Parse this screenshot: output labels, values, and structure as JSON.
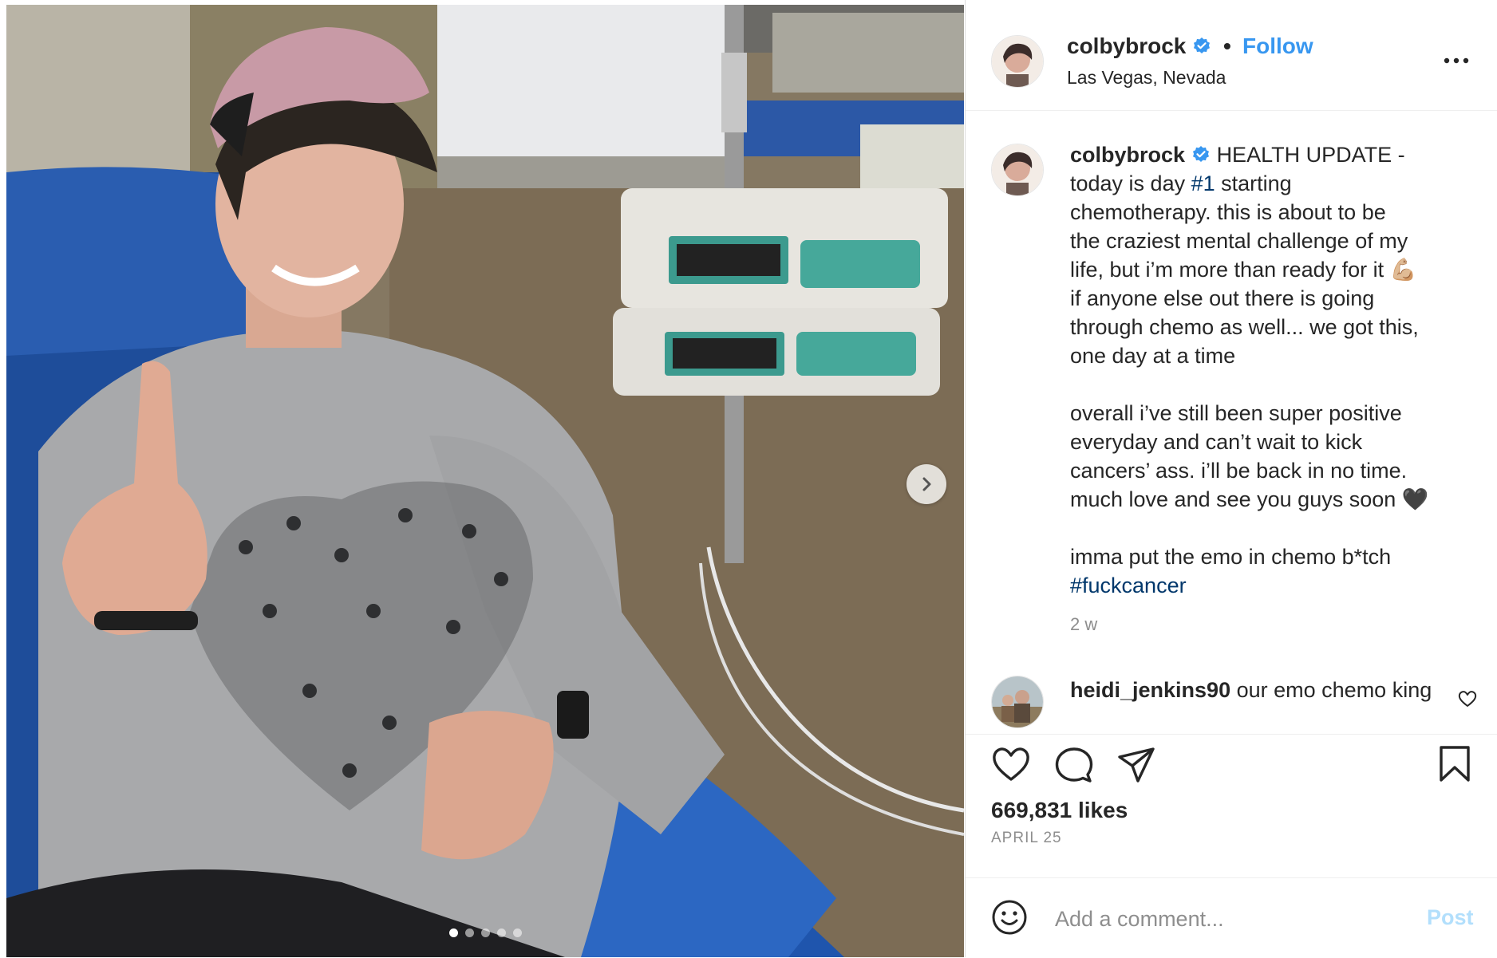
{
  "post": {
    "username": "colbybrock",
    "follow_label": "Follow",
    "separator": "•",
    "location": "Las Vegas, Nevada",
    "caption_lines": [
      "HEALTH UPDATE -",
      "today is day ",
      "#1",
      " starting\nchemotherapy. this is about to be\nthe craziest mental challenge of my\nlife, but i’m more than ready for it 💪🏼\nif anyone else out there is going\nthrough chemo as well... we got this,\none day at a time\n\noverall i’ve still been super positive\neveryday and can’t wait to kick\ncancers’ ass. i’ll be back in no time.\nmuch love and see you guys soon 🖤\n\nimma put the emo in chemo b*tch\n",
      "#fuckcancer"
    ],
    "time_ago": "2 w",
    "likes": "669,831 likes",
    "date": "APRIL 25"
  },
  "comment": {
    "username": "heidi_jenkins90",
    "text": "our emo chemo king"
  },
  "add_comment": {
    "placeholder": "Add a comment...",
    "post_label": "Post"
  },
  "carousel": {
    "count": 5,
    "active_index": 0
  },
  "icons": {
    "verified": "verified-badge-icon",
    "more": "more-options-icon",
    "like": "heart-icon",
    "comment": "comment-bubble-icon",
    "share": "paper-plane-icon",
    "save": "bookmark-icon",
    "emoji": "emoji-smiley-icon",
    "next": "chevron-right-icon"
  },
  "colors": {
    "follow": "#3897f0",
    "verified": "#3897f0",
    "hashtag": "#00376b",
    "post_disabled": "#b2dffc",
    "muted": "#8e8e8e"
  }
}
